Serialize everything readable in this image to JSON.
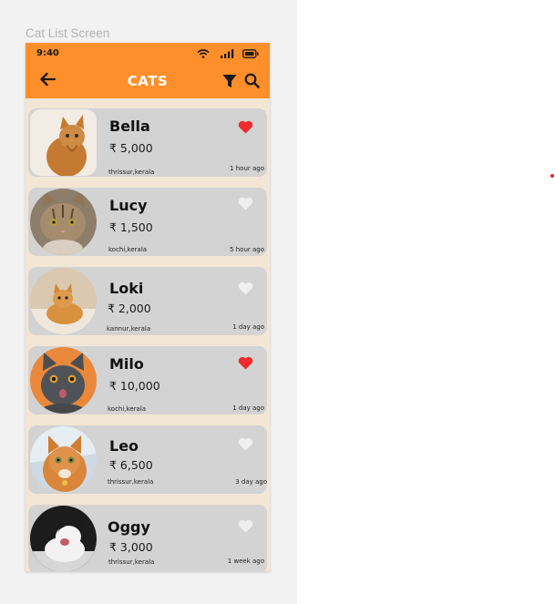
{
  "frame_label": "Cat List Screen",
  "status_bar": {
    "time": "9:40"
  },
  "app_bar": {
    "title": "CATS"
  },
  "colors": {
    "accent": "#fe8f2a",
    "favorite": "#ef2b2b",
    "not_favorite": "#efefef"
  },
  "cats": [
    {
      "name": "Bella",
      "price": "₹ 5,000",
      "location": "thrissur,kerala",
      "time": "1 hour ago",
      "favorite": true
    },
    {
      "name": "Lucy",
      "price": "₹ 1,500",
      "location": "kochi,kerala",
      "time": "5 hour ago",
      "favorite": false
    },
    {
      "name": "Loki",
      "price": "₹ 2,000",
      "location": "kannur,kerala",
      "time": "1 day ago",
      "favorite": false
    },
    {
      "name": "Milo",
      "price": "₹ 10,000",
      "location": "kochi,kerala",
      "time": "1 day ago",
      "favorite": true
    },
    {
      "name": "Leo",
      "price": "₹ 6,500",
      "location": "thrissur,kerala",
      "time": "3 day ago",
      "favorite": false
    },
    {
      "name": "Oggy",
      "price": "₹ 3,000",
      "location": "thrissur,kerala",
      "time": "1 week ago",
      "favorite": false
    }
  ]
}
